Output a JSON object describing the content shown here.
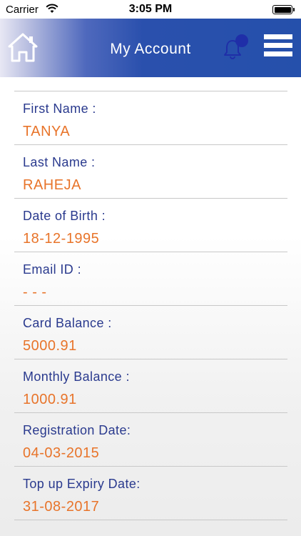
{
  "status_bar": {
    "carrier": "Carrier",
    "time": "3:05 PM",
    "wifi_icon": "wifi-icon",
    "battery_icon": "battery-full-icon"
  },
  "header": {
    "title": "My Account",
    "home_icon": "home-icon",
    "bell_icon": "bell-icon",
    "menu_icon": "hamburger-menu-icon",
    "colors": {
      "bar": "#2550ab",
      "title_text": "#ffffff",
      "notification_dot": "#1f2ea8"
    }
  },
  "account": {
    "fields": [
      {
        "label": "First Name :",
        "value": "TANYA"
      },
      {
        "label": "Last Name :",
        "value": "RAHEJA"
      },
      {
        "label": "Date of Birth :",
        "value": "18-12-1995"
      },
      {
        "label": "Email ID :",
        "value": "- - -"
      },
      {
        "label": "Card Balance :",
        "value": "5000.91"
      },
      {
        "label": "Monthly Balance :",
        "value": "1000.91"
      },
      {
        "label": "Registration Date:",
        "value": "04-03-2015"
      },
      {
        "label": "Top up Expiry Date:",
        "value": "31-08-2017"
      }
    ],
    "colors": {
      "label": "#2a3a8e",
      "value": "#e8742a",
      "divider": "#c8c8c8"
    }
  }
}
